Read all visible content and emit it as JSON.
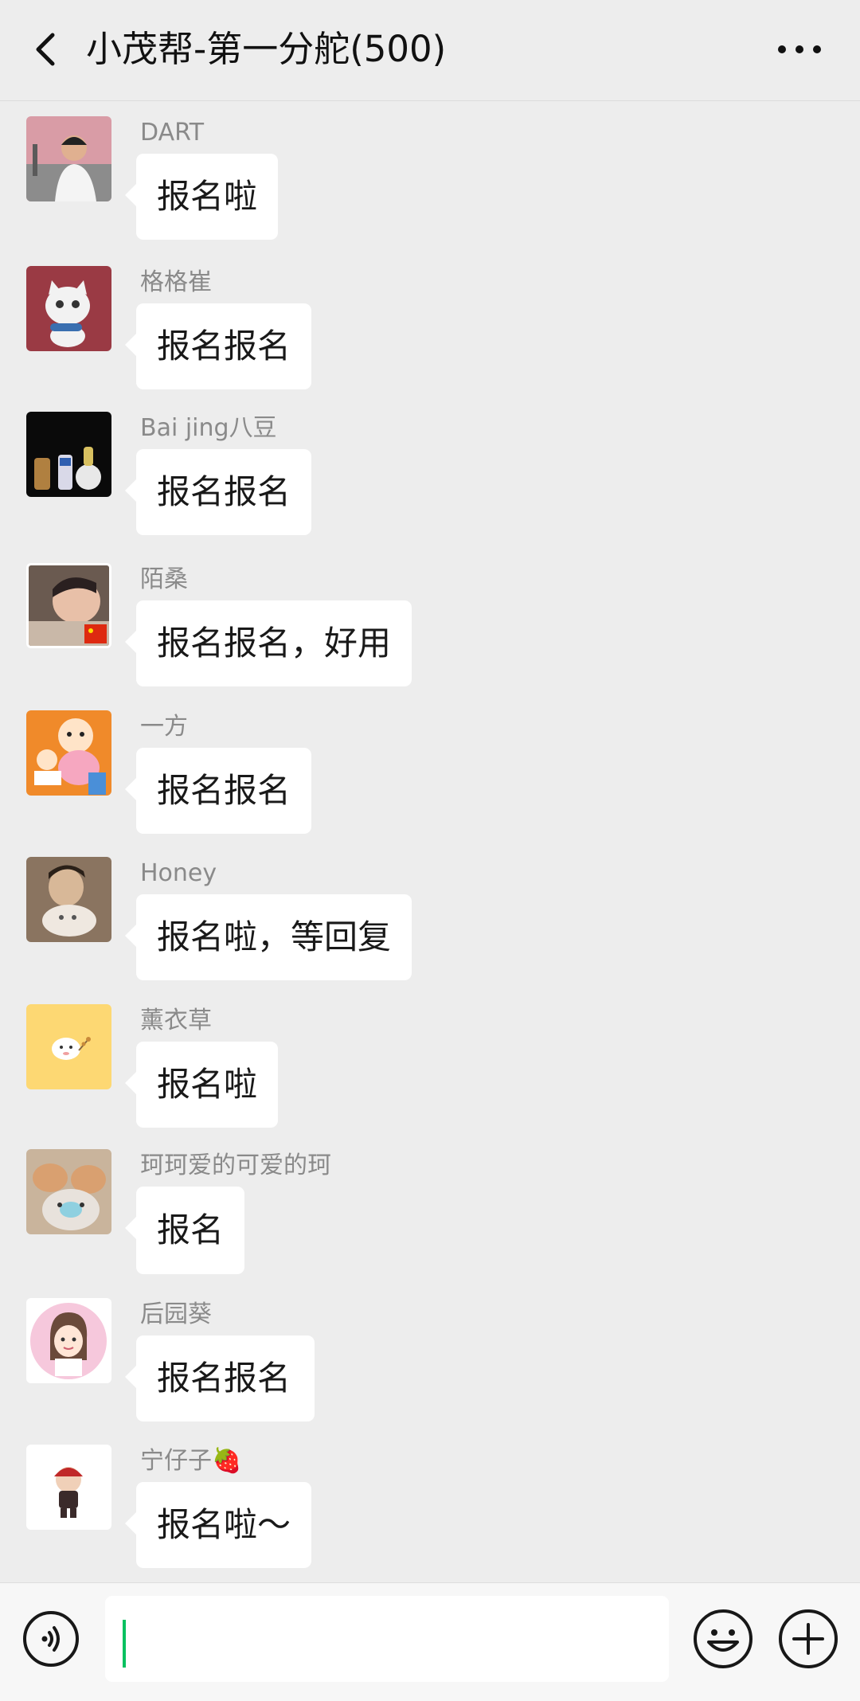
{
  "header": {
    "title": "小茂帮-第一分舵(500)"
  },
  "messages": [
    {
      "name": "DART",
      "text": "报名啦",
      "avatar": "avatar-photo-man"
    },
    {
      "name": "格格崔",
      "text": "报名报名",
      "avatar": "avatar-cat-guitar"
    },
    {
      "name": "Bai jing八豆",
      "text": "报名报名",
      "avatar": "avatar-dark-bottles"
    },
    {
      "name": "陌桑",
      "text": "报名报名，好用",
      "avatar": "avatar-baby-flag"
    },
    {
      "name": "一方",
      "text": "报名报名",
      "avatar": "avatar-cartoon-kids"
    },
    {
      "name": "Honey",
      "text": "报名啦，等回复",
      "avatar": "avatar-man-cat"
    },
    {
      "name": "薰衣草",
      "text": "报名啦",
      "avatar": "avatar-yellow-cartoon"
    },
    {
      "name": "珂珂爱的可爱的珂",
      "text": "报名",
      "avatar": "avatar-plush-toys"
    },
    {
      "name": "后园葵",
      "text": "报名报名",
      "avatar": "avatar-girl-cartoon"
    },
    {
      "name": "宁仔子🍓",
      "text": "报名啦～",
      "avatar": "avatar-small-figure"
    }
  ],
  "input": {
    "value": ""
  },
  "icons": {
    "back": "chevron-left-icon",
    "more": "more-dots-icon",
    "voice": "voice-icon",
    "emoji": "emoji-icon",
    "plus": "plus-icon"
  }
}
